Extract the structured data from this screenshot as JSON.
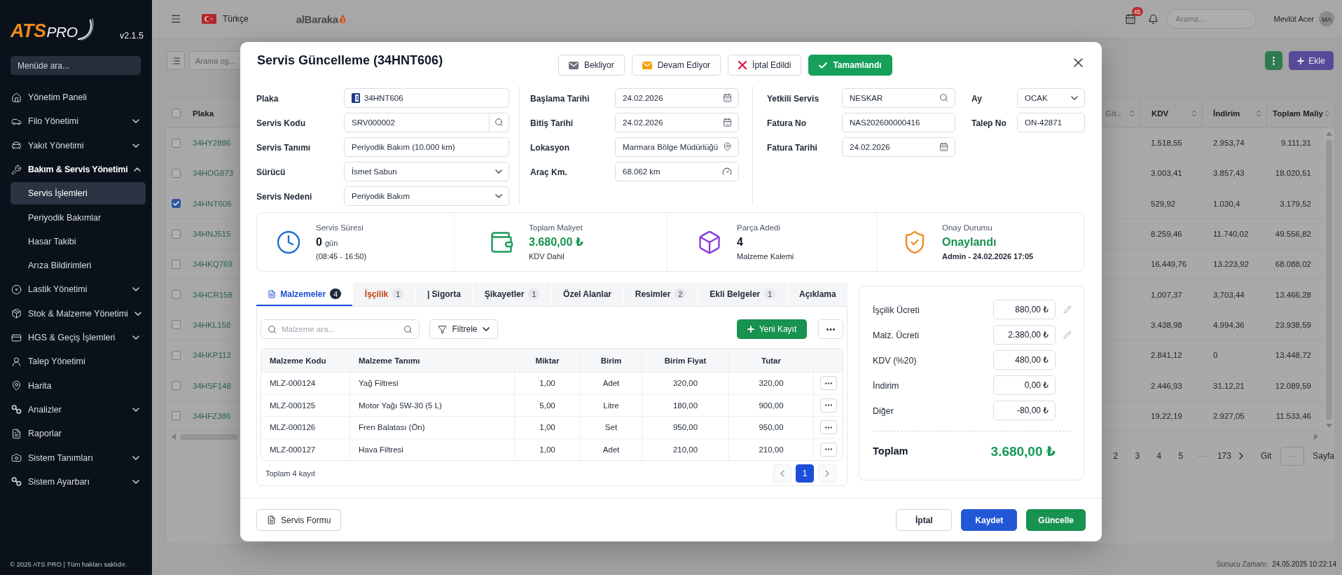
{
  "sidebar": {
    "logo": {
      "brand": "ATS",
      "suffix": "PRO"
    },
    "version": "v2.1.5",
    "search": {
      "placeholder": "Menüde ara..."
    },
    "items": [
      {
        "label": "Yönetim Paneli",
        "kind": "link",
        "selected": false
      },
      {
        "label": "Filo Yönetimi",
        "kind": "group",
        "selected": false,
        "expanded": false
      },
      {
        "label": "Yakıt Yönetimi",
        "kind": "group",
        "selected": false,
        "expanded": false
      },
      {
        "label": "Bakım & Servis Yönetimi",
        "kind": "group",
        "selected": false,
        "expanded": true,
        "children": [
          {
            "label": "Servis İşlemleri",
            "selected": true
          },
          {
            "label": "Periyodik Bakımlar",
            "selected": false
          },
          {
            "label": "Hasar Takibi",
            "selected": false
          },
          {
            "label": "Arıza Bildirimleri",
            "selected": false
          }
        ]
      },
      {
        "label": "Lastik Yönetimi",
        "kind": "group",
        "selected": false,
        "expanded": false
      },
      {
        "label": "Stok & Malzeme Yönetimi",
        "kind": "group",
        "selected": false,
        "expanded": false
      },
      {
        "label": "HGS & Geçiş İşlemleri",
        "kind": "group",
        "selected": false,
        "expanded": false
      },
      {
        "label": "Talep Yönetimi",
        "kind": "link",
        "selected": false
      },
      {
        "label": "Harita",
        "kind": "link",
        "selected": false
      },
      {
        "label": "Analizler",
        "kind": "group",
        "selected": false,
        "expanded": false
      },
      {
        "label": "Raporlar",
        "kind": "link",
        "selected": false
      },
      {
        "label": "Sistem Tanımları",
        "kind": "group",
        "selected": false,
        "expanded": false
      },
      {
        "label": "Sistem Ayarbarı",
        "kind": "group",
        "selected": false,
        "expanded": false
      }
    ],
    "footer": "© 2025 ATS PRO | Tüm hakları saklıdır."
  },
  "header": {
    "language": "Türkçe",
    "bank_logo": "alBaraka",
    "notification_count": "45",
    "search": {
      "placeholder": "Arama..."
    },
    "user": {
      "name": "Mevlüt Acer",
      "initials": "MA"
    }
  },
  "toolbar": {
    "search": {
      "placeholder": "Arama og..."
    },
    "add_button": "Ekle"
  },
  "vehicle_table": {
    "all_selected": false,
    "columns": [
      "Plaka",
      "Git..",
      "KDV",
      "İndirim",
      "Toplam Maliy"
    ],
    "rows": [
      {
        "selected": false,
        "plate": "34HY2886",
        "kdv": "1.518,55",
        "discount": "2.953,74",
        "total": "9.111,31"
      },
      {
        "selected": false,
        "plate": "34HOG873",
        "kdv": "3.003,41",
        "discount": "3.857,43",
        "total": "18.020,51"
      },
      {
        "selected": true,
        "plate": "34HNT606",
        "kdv": "529,92",
        "discount": "1.030,4",
        "total": "3.179,52"
      },
      {
        "selected": false,
        "plate": "34HNJ515",
        "kdv": "8.259,46",
        "discount": "11.740,02",
        "total": "49.556,82"
      },
      {
        "selected": false,
        "plate": "34HKQ769",
        "kdv": "16.449,76",
        "discount": "13.223,92",
        "total": "68.088,02"
      },
      {
        "selected": false,
        "plate": "34HCR158",
        "kdv": "1,007,37",
        "discount": "3,703,44",
        "total": "13.466,28"
      },
      {
        "selected": false,
        "plate": "34HKL158",
        "kdv": "3.438,98",
        "discount": "4.994,36",
        "total": "23.938,59"
      },
      {
        "selected": false,
        "plate": "34HKP112",
        "kdv": "2.841,12",
        "discount": "0",
        "total": "13.448,72"
      },
      {
        "selected": false,
        "plate": "34HSF148",
        "kdv": "2.446,93",
        "discount": "31.12,21",
        "total": "12.089,59"
      },
      {
        "selected": false,
        "plate": "34HFZ386",
        "kdv": "19,22,19",
        "discount": "2.927,05",
        "total": "11.533,46"
      }
    ],
    "pagination": {
      "pages": [
        {
          "label": "2",
          "selected": false
        },
        {
          "label": "3",
          "selected": false
        },
        {
          "label": "4",
          "selected": false
        },
        {
          "label": "5",
          "selected": false
        }
      ],
      "gap": "···",
      "last_page": {
        "label": "173",
        "selected": false
      },
      "go_label": "Git",
      "page_input": {
        "placeholder": "···"
      },
      "page_suffix": "Sayfa"
    }
  },
  "footer": {
    "server_time_label": "Sunucu Zamanı:",
    "server_time": "24.05.2025 10:22:14"
  },
  "modal": {
    "title": "Servis Güncelleme (34HNT606)",
    "statuses": [
      {
        "label": "Bekliyor",
        "selected": false,
        "color": "#6b7280"
      },
      {
        "label": "Devam Ediyor",
        "selected": false,
        "color": "#f59e0b"
      },
      {
        "label": "İptal Edildi",
        "selected": false,
        "color": "#e11d48"
      },
      {
        "label": "Tamamlandı",
        "selected": true,
        "color": "#16a05a"
      }
    ],
    "form": {
      "columns": [
        {
          "fields": [
            {
              "label": "Plaka",
              "value": "34HNT606",
              "kind": "plate"
            },
            {
              "label": "Servis Kodu",
              "value": "SRV000002",
              "kind": "lookup"
            },
            {
              "label": "Servis Tanımı",
              "value": "Periyodik Bakım (10.000 km)",
              "kind": "text"
            },
            {
              "label": "Sürücü",
              "value": "İsmet Sabun",
              "kind": "select"
            },
            {
              "label": "Servis Nedeni",
              "value": "Periyodik Bakım",
              "kind": "select"
            }
          ]
        },
        {
          "fields": [
            {
              "label": "Başlama Tarihi",
              "value": "24.02.2026",
              "kind": "date"
            },
            {
              "label": "Bitiş Tarihi",
              "value": "24.02.2026",
              "kind": "date"
            },
            {
              "label": "Lokasyon",
              "value": "Marmara Bölge Müdürlüğü",
              "kind": "location"
            },
            {
              "label": "Araç Km.",
              "value": "68.062 km",
              "kind": "odometer"
            }
          ]
        },
        {
          "fields": [
            {
              "label": "Yetkili Servis",
              "value": "NESKAR",
              "kind": "search"
            },
            {
              "label": "Fatura No",
              "value": "NAS202600000416",
              "kind": "text"
            },
            {
              "label": "Fatura Tarihi",
              "value": "24.02.2026",
              "kind": "date"
            }
          ]
        },
        {
          "fields": [
            {
              "label": "Ay",
              "value": "OCAK",
              "kind": "select"
            },
            {
              "label": "Talep No",
              "value": "ON-42871",
              "kind": "text"
            }
          ]
        }
      ]
    },
    "summary": [
      {
        "title": "Servis Süresi",
        "value": "0",
        "unit": "gün",
        "note": "(08:45 - 16:50)",
        "color": "#1f6fd0",
        "highlighted": false
      },
      {
        "title": "Toplam Maliyet",
        "value": "3.680,00 ₺",
        "note": "KDV Dahil",
        "color": "#1a9a5a",
        "highlighted": true
      },
      {
        "title": "Parça Adedi",
        "value": "4",
        "note": "Malzeme Kalemi",
        "color": "#8b3fd9",
        "highlighted": false
      },
      {
        "title": "Onay Durumu",
        "value": "Onaylandı",
        "note": "Admin - 24.02.2026 17:05",
        "color": "#f08a24",
        "highlighted": true
      }
    ],
    "tabs": [
      {
        "label": "Malzemeler",
        "count": "4",
        "selected": true,
        "warning": false
      },
      {
        "label": "İşçilik",
        "count": "1",
        "selected": false,
        "warning": true
      },
      {
        "label": "| Sigorta",
        "selected": false,
        "warning": false
      },
      {
        "label": "Şikayetler",
        "count": "1",
        "selected": false,
        "warning": false
      },
      {
        "label": "Özel Alanlar",
        "selected": false,
        "warning": false
      },
      {
        "label": "Resimler",
        "count": "2",
        "selected": false,
        "warning": false
      },
      {
        "label": "Ekli Belgeler",
        "count": "1",
        "selected": false,
        "warning": false
      },
      {
        "label": "Açıklama",
        "selected": false,
        "warning": false
      }
    ],
    "materials": {
      "search": {
        "placeholder": "Malzeme ara..."
      },
      "filter_button": "Filtrele",
      "add_button": "Yeni Kayıt",
      "columns": [
        "Malzeme Kodu",
        "Malzeme Tanımı",
        "Miktar",
        "Birim",
        "Birim Fiyat",
        "Tutar"
      ],
      "rows": [
        [
          "MLZ-000124",
          "Yağ Filtresi",
          "1,00",
          "Adet",
          "320,00",
          "320,00"
        ],
        [
          "MLZ-000125",
          "Motor Yağı 5W-30 (5 L)",
          "5,00",
          "Litre",
          "180,00",
          "900,00"
        ],
        [
          "MLZ-000126",
          "Fren Balatası (Ön)",
          "1,00",
          "Set",
          "950,00",
          "950,00"
        ],
        [
          "MLZ-000127",
          "Hava Filtresi",
          "1,00",
          "Adet",
          "210,00",
          "210,00"
        ]
      ],
      "total_text": "Toplam 4 kayıt",
      "pages": [
        {
          "label": "1",
          "selected": true
        }
      ]
    },
    "costs": {
      "rows": [
        {
          "label": "İşçilik Ücreti",
          "value": "880,00 ₺",
          "editable": true
        },
        {
          "label": "Malz. Ücreti",
          "value": "2.380,00 ₺",
          "editable": true
        },
        {
          "label": "KDV (%20)",
          "value": "480,00 ₺",
          "editable": false
        },
        {
          "label": "İndirim",
          "value": "0,00 ₺",
          "editable": false
        },
        {
          "label": "Diğer",
          "value": "-80,00 ₺",
          "editable": false
        }
      ],
      "total": {
        "label": "Toplam",
        "value": "3.680,00 ₺"
      }
    },
    "footer": {
      "form_button": "Servis Formu",
      "actions": [
        {
          "label": "İptal",
          "kind": "cancel"
        },
        {
          "label": "Kaydet",
          "kind": "save"
        },
        {
          "label": "Güncelle",
          "kind": "update"
        }
      ]
    }
  }
}
